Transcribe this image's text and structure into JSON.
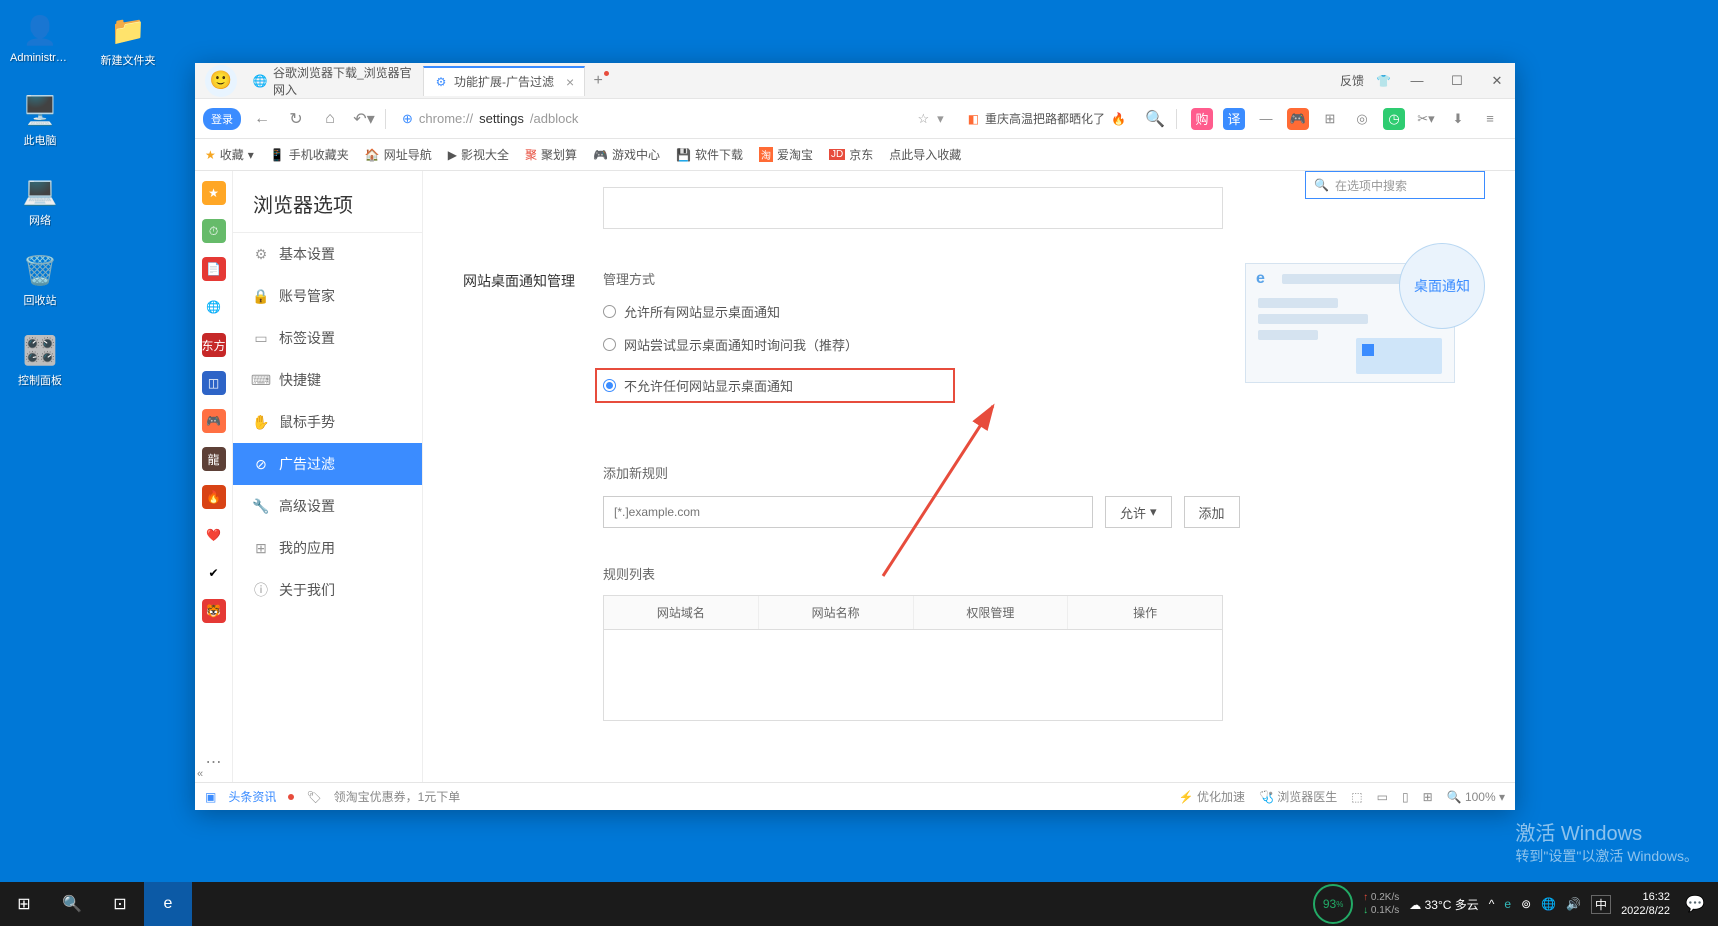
{
  "desktop": {
    "icons": [
      {
        "label": "Administra...",
        "glyph": "👤",
        "bg": "#fff"
      },
      {
        "label": "新建文件夹",
        "glyph": "📁",
        "bg": ""
      },
      {
        "label": "此电脑",
        "glyph": "🖥️",
        "bg": ""
      },
      {
        "label": "网络",
        "glyph": "💻",
        "bg": ""
      },
      {
        "label": "回收站",
        "glyph": "🗑️",
        "bg": ""
      },
      {
        "label": "控制面板",
        "glyph": "🎛️",
        "bg": ""
      }
    ]
  },
  "browser": {
    "tabs": [
      {
        "icon": "🌐",
        "label": "谷歌浏览器下载_浏览器官网入",
        "active": false
      },
      {
        "icon": "⚙",
        "label": "功能扩展-广告过滤",
        "active": true
      }
    ],
    "title_right": {
      "feedback": "反馈"
    },
    "login": "登录",
    "url": {
      "proto": "chrome://",
      "mid": "settings",
      "tail": "/adblock"
    },
    "headline": {
      "text": "重庆高温把路都晒化了"
    },
    "bookmarks": [
      "收藏",
      "手机收藏夹",
      "网址导航",
      "影视大全",
      "聚划算",
      "游戏中心",
      "软件下载",
      "爱淘宝",
      "京东",
      "点此导入收藏"
    ],
    "sidebar_title": "浏览器选项",
    "sidebar": [
      {
        "icon": "⚙",
        "label": "基本设置"
      },
      {
        "icon": "🔒",
        "label": "账号管家"
      },
      {
        "icon": "▭",
        "label": "标签设置"
      },
      {
        "icon": "⌨",
        "label": "快捷键"
      },
      {
        "icon": "✋",
        "label": "鼠标手势"
      },
      {
        "icon": "⊘",
        "label": "广告过滤"
      },
      {
        "icon": "🔧",
        "label": "高级设置"
      },
      {
        "icon": "⊞",
        "label": "我的应用"
      },
      {
        "icon": "ⓘ",
        "label": "关于我们"
      }
    ],
    "search_placeholder": "在选项中搜索",
    "section_label": "网站桌面通知管理",
    "mgmt_title": "管理方式",
    "radios": [
      "允许所有网站显示桌面通知",
      "网站尝试显示桌面通知时询问我（推荐）",
      "不允许任何网站显示桌面通知"
    ],
    "bubble_text": "桌面通知",
    "add_rule_title": "添加新规则",
    "rule_placeholder": "[*.]example.com",
    "allow_btn": "允许",
    "add_btn": "添加",
    "list_title": "规则列表",
    "table_headers": [
      "网站域名",
      "网站名称",
      "权限管理",
      "操作"
    ],
    "status": {
      "headlines": "头条资讯",
      "coupon": "领淘宝优惠券，1元下单",
      "optimize": "优化加速",
      "doctor": "浏览器医生",
      "zoom": "100%"
    }
  },
  "watermark": {
    "line1": "激活 Windows",
    "line2": "转到\"设置\"以激活 Windows。"
  },
  "taskbar": {
    "speed": "93",
    "speed_sub": "%",
    "net1": "0.2K/s",
    "net2": "0.1K/s",
    "weather": "33°C 多云",
    "ime": "中",
    "time": "16:32",
    "date": "2022/8/22"
  }
}
